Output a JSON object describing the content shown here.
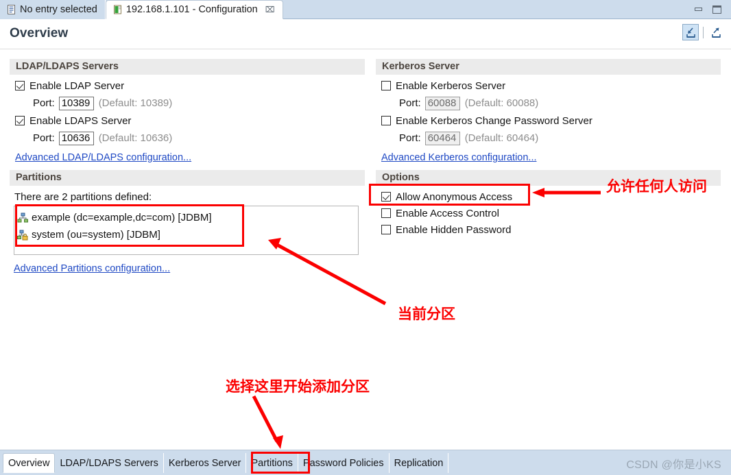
{
  "window": {
    "tabs": [
      {
        "label": "No entry selected",
        "icon": "document-icon",
        "active": false,
        "closable": false
      },
      {
        "label": "192.168.1.101 - Configuration",
        "icon": "server-config-icon",
        "active": true,
        "closable": true,
        "close_glyph": "⌧"
      }
    ],
    "controls": [
      {
        "name": "minimize-button",
        "glyph": "minimize-icon"
      },
      {
        "name": "restore-button",
        "glyph": "restore-icon"
      }
    ]
  },
  "editor": {
    "title": "Overview",
    "tools": [
      {
        "name": "collapse-all-icon",
        "selected": true
      },
      {
        "name": "expand-maximize-icon",
        "selected": false
      }
    ]
  },
  "sections": {
    "ldap": {
      "title": "LDAP/LDAPS Servers",
      "checks": [
        {
          "label": "Enable LDAP Server",
          "checked": true
        },
        {
          "label": "Enable LDAPS Server",
          "checked": true
        }
      ],
      "ports": [
        {
          "label": "Port:",
          "value": "10389",
          "default": "(Default: 10389)",
          "disabled": false
        },
        {
          "label": "Port:",
          "value": "10636",
          "default": "(Default: 10636)",
          "disabled": false
        }
      ],
      "link": "Advanced LDAP/LDAPS configuration..."
    },
    "kerberos": {
      "title": "Kerberos Server",
      "checks": [
        {
          "label": "Enable Kerberos Server",
          "checked": false
        },
        {
          "label": "Enable Kerberos Change Password Server",
          "checked": false
        }
      ],
      "ports": [
        {
          "label": "Port:",
          "value": "60088",
          "default": "(Default: 60088)",
          "disabled": true
        },
        {
          "label": "Port:",
          "value": "60464",
          "default": "(Default: 60464)",
          "disabled": true
        }
      ],
      "link": "Advanced Kerberos configuration..."
    },
    "partitions": {
      "title": "Partitions",
      "note": "There are 2 partitions defined:",
      "items": [
        {
          "label": "example (dc=example,dc=com) [JDBM]",
          "icon": "partition-icon",
          "locked": false
        },
        {
          "label": "system (ou=system) [JDBM]",
          "icon": "partition-locked-icon",
          "locked": true
        }
      ],
      "link": "Advanced Partitions configuration..."
    },
    "options": {
      "title": "Options",
      "checks": [
        {
          "label": "Allow Anonymous Access",
          "checked": true
        },
        {
          "label": "Enable Access Control",
          "checked": false
        },
        {
          "label": "Enable Hidden Password",
          "checked": false
        }
      ]
    }
  },
  "bottom_tabs": [
    {
      "label": "Overview",
      "active": true
    },
    {
      "label": "LDAP/LDAPS Servers",
      "active": false
    },
    {
      "label": "Kerberos Server",
      "active": false
    },
    {
      "label": "Partitions",
      "active": false
    },
    {
      "label": "Password Policies",
      "active": false
    },
    {
      "label": "Replication",
      "active": false
    }
  ],
  "watermark": "CSDN @你是小KS",
  "annotations": {
    "color": "#fb0000",
    "labels": [
      {
        "name": "annotation-allow-anonymous",
        "text": "允许任何人访问"
      },
      {
        "name": "annotation-current-partition",
        "text": "当前分区"
      },
      {
        "name": "annotation-add-partition",
        "text": "选择这里开始添加分区"
      }
    ]
  }
}
